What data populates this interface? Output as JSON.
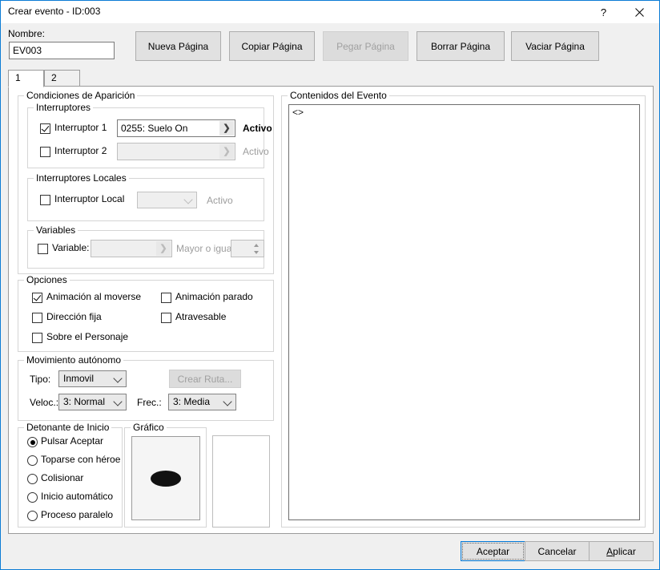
{
  "window": {
    "title": "Crear evento - ID:003",
    "help_icon": "question-mark-icon",
    "close_icon": "close-x-icon",
    "accent_color": "#0c7cd5"
  },
  "header": {
    "name_label": "Nombre:",
    "name_value": "EV003",
    "name_placeholder": "",
    "buttons": [
      {
        "key": "nueva",
        "label": "Nueva Página",
        "enabled": true
      },
      {
        "key": "copiar",
        "label": "Copiar Página",
        "enabled": true
      },
      {
        "key": "pegar",
        "label": "Pegar Página",
        "enabled": false
      },
      {
        "key": "borrar",
        "label": "Borrar Página",
        "enabled": true
      },
      {
        "key": "vaciar",
        "label": "Vaciar Página",
        "enabled": true
      }
    ]
  },
  "tabs": [
    {
      "label": "1",
      "active": true
    },
    {
      "label": "2",
      "active": false
    }
  ],
  "conditions": {
    "title": "Condiciones de Aparición",
    "switches": {
      "title": "Interruptores",
      "rows": [
        {
          "checkbox_label": "Interruptor 1",
          "checked": true,
          "value": "0255: Suelo On",
          "state_label": "Activo",
          "enabled": true,
          "browse_icon": "chevron-right-icon"
        },
        {
          "checkbox_label": "Interruptor 2",
          "checked": false,
          "value": "",
          "state_label": "Activo",
          "enabled": false,
          "browse_icon": "chevron-right-icon"
        }
      ]
    },
    "local_switches": {
      "title": "Interruptores Locales",
      "checkbox_label": "Interruptor Local",
      "checked": false,
      "value": "",
      "state_label": "Activo",
      "dropdown_icon": "chevron-down-icon"
    },
    "variables": {
      "title": "Variables",
      "checkbox_label": "Variable:",
      "checked": false,
      "value": "",
      "comparison_label": "Mayor o igual",
      "amount": "",
      "browse_icon": "chevron-right-icon",
      "spinner_icon": "up-down-spinner-icon"
    }
  },
  "options": {
    "title": "Opciones",
    "items": [
      {
        "label": "Animación al moverse",
        "checked": true
      },
      {
        "label": "Animación parado",
        "checked": false
      },
      {
        "label": "Dirección fija",
        "checked": false
      },
      {
        "label": "Atravesable",
        "checked": false
      },
      {
        "label": "Sobre el Personaje",
        "checked": false
      }
    ]
  },
  "autonomous_movement": {
    "title": "Movimiento autónomo",
    "type_label": "Tipo:",
    "type_value": "Inmovil",
    "route_button_label": "Crear Ruta...",
    "route_button_enabled": false,
    "speed_label": "Veloc.:",
    "speed_value": "3: Normal",
    "freq_label": "Frec.:",
    "freq_value": "3: Media"
  },
  "trigger": {
    "title": "Detonante de Inicio",
    "items": [
      {
        "label": "Pulsar Aceptar",
        "selected": true
      },
      {
        "label": "Toparse con héroe",
        "selected": false
      },
      {
        "label": "Colisionar",
        "selected": false
      },
      {
        "label": "Inicio automático",
        "selected": false
      },
      {
        "label": "Proceso paralelo",
        "selected": false
      }
    ]
  },
  "graphic": {
    "title": "Gráfico",
    "sprite_icon": "black-ellipse-sprite",
    "second_panel_empty": true
  },
  "event_contents": {
    "title": "Contenidos del Evento",
    "lines": [
      "<>"
    ]
  },
  "footer": {
    "accept_label": "Aceptar",
    "cancel_label": "Cancelar",
    "apply_label": "Aplicar"
  }
}
